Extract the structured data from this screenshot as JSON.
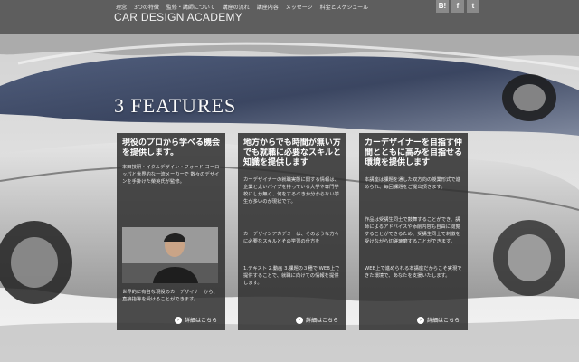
{
  "header": {
    "logo": "CAR DESIGN ACADEMY",
    "nav": [
      "理念",
      "3つの特徴",
      "監修・講師について",
      "講座の流れ",
      "講座内容",
      "メッセージ",
      "料金とスケジュール"
    ],
    "social": [
      "B!",
      "f",
      "t"
    ]
  },
  "main": {
    "section_title": "3 FEATURES",
    "cards": [
      {
        "title": "現役のプロから学べる機会を提供します。",
        "body": "本田技研・イタルデザイン・フォード ヨーロッパと世界的な一流メーカーで 数々のデザインを手掛けた榮英氏が監修。",
        "body2": "世界的に有名な現役のカーデザイナーから、直接指導を受けることができます。",
        "more": "詳細はこちら"
      },
      {
        "title": "地方からでも時間が無い方でも就職に必要なスキルと知識を提供します",
        "body": "カーデザイナーの就職実態に関する情報は、企業と太いパイプを持っている大学や専門学校にしか無く、何をするべきか分からない学生が多いのが現状です。",
        "body2": "カーデザインアカデミーは、そのような方々に必要なスキルとその学習の仕方を",
        "body3": "1.テキスト 2.動画 3.課題の３種で WEB上で提供することで、就職に向けての情報を提供します。",
        "more": "詳細はこちら"
      },
      {
        "title": "カーデザイナーを目指す仲間とともに高みを目指せる環境を提供します",
        "body": "本講座は課題を通した双方向の授業形式で進められ、毎回課題をご提出頂きます。",
        "body2": "作品は受講生同士で鼓舞することができ、講師によるアドバイスや添削内容も自由に閲覧することができるため、受講生同士で刺激を受けながら切磋琢磨することができます。",
        "body3": "WEB上で進められる本講座だからこそ実現できた環境で、あなたを支援いたします。",
        "more": "詳細はこちら"
      }
    ]
  }
}
